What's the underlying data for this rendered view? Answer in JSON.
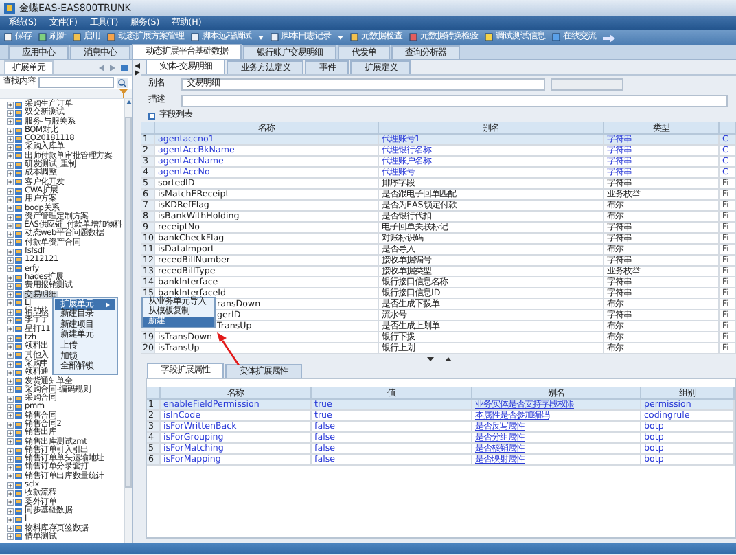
{
  "window": {
    "title": "金蝶EAS-EAS800TRUNK"
  },
  "menu": [
    "系统(S)",
    "文件(F)",
    "工具(T)",
    "服务(S)",
    "帮助(H)"
  ],
  "toolbar": [
    {
      "label": "保存",
      "dropdown": false
    },
    {
      "label": "刷新",
      "dropdown": false
    },
    {
      "label": "启用",
      "dropdown": false
    },
    {
      "label": "动态扩展方案管理",
      "dropdown": false
    },
    {
      "label": "脚本远程调试",
      "dropdown": true
    },
    {
      "label": "脚本日志记录",
      "dropdown": true
    },
    {
      "label": "元数据检查",
      "dropdown": false
    },
    {
      "label": "元数据转换检验",
      "dropdown": false
    },
    {
      "label": "调试测试信息",
      "dropdown": false
    },
    {
      "label": "在线交流",
      "dropdown": false
    }
  ],
  "tabs": [
    {
      "label": "应用中心",
      "selected": false
    },
    {
      "label": "消息中心",
      "selected": false
    },
    {
      "label": "动态扩展平台基础数据",
      "selected": true
    },
    {
      "label": "银行账户交易明细",
      "selected": false
    },
    {
      "label": "代发单",
      "selected": false
    },
    {
      "label": "查询分析器",
      "selected": false
    }
  ],
  "left_panel": {
    "title": "扩展单元",
    "search_label": "查找内容",
    "tree": [
      {
        "label": "采购生产订单",
        "selected": false
      },
      {
        "label": "双交新测试",
        "selected": false
      },
      {
        "label": "服务-与服关系",
        "selected": false
      },
      {
        "label": "BOM对比",
        "selected": false
      },
      {
        "label": "CO20181118",
        "selected": false
      },
      {
        "label": "采购入库单",
        "selected": false
      },
      {
        "label": "出师付款单审批管理方案",
        "selected": false
      },
      {
        "label": "研发测试_重制",
        "selected": false
      },
      {
        "label": "成本调整",
        "selected": false
      },
      {
        "label": "客户化开发",
        "selected": false
      },
      {
        "label": "CWA扩展",
        "selected": false
      },
      {
        "label": "用户方案",
        "selected": false
      },
      {
        "label": "bodp关系",
        "selected": false
      },
      {
        "label": "资产管理定制方案",
        "selected": false
      },
      {
        "label": "EAS供应链_付款单增加物料",
        "selected": false
      },
      {
        "label": "动态web平台问题数据",
        "selected": false
      },
      {
        "label": "付款单资产合同",
        "selected": false
      },
      {
        "label": "fsfsdf",
        "selected": false
      },
      {
        "label": "1212121",
        "selected": false
      },
      {
        "label": "erfy",
        "selected": false
      },
      {
        "label": "hades扩展",
        "selected": false
      },
      {
        "label": "费用报销测试",
        "selected": false
      },
      {
        "label": "交易明细",
        "selected": true
      },
      {
        "label": "LJ",
        "selected": false
      },
      {
        "label": "辅助核",
        "selected": false
      },
      {
        "label": "李宇宇",
        "selected": false
      },
      {
        "label": "星打11",
        "selected": false
      },
      {
        "label": "tzh",
        "selected": false
      },
      {
        "label": "领料出",
        "selected": false
      },
      {
        "label": "其他入",
        "selected": false
      },
      {
        "label": "采购申",
        "selected": false
      },
      {
        "label": "领料通",
        "selected": false
      },
      {
        "label": "发货通知单全",
        "selected": false
      },
      {
        "label": "采购合同-编码规则",
        "selected": false
      },
      {
        "label": "采购合同",
        "selected": false
      },
      {
        "label": "pmm",
        "selected": false
      },
      {
        "label": "销售合同",
        "selected": false
      },
      {
        "label": "销售合同2",
        "selected": false
      },
      {
        "label": "销售出库",
        "selected": false
      },
      {
        "label": "销售出库测试zmt",
        "selected": false
      },
      {
        "label": "销售订单引入引出",
        "selected": false
      },
      {
        "label": "销售订单单头运输地址",
        "selected": false
      },
      {
        "label": "销售订单分录套打",
        "selected": false
      },
      {
        "label": "销售订单出库数量统计",
        "selected": false
      },
      {
        "label": "sclx",
        "selected": false
      },
      {
        "label": "收款流程",
        "selected": false
      },
      {
        "label": "委外订单",
        "selected": false
      },
      {
        "label": "同步基础数据",
        "selected": false
      },
      {
        "label": "l",
        "selected": false
      },
      {
        "label": "物料库存页签数据",
        "selected": false
      },
      {
        "label": "借单测试",
        "selected": false
      }
    ]
  },
  "entity_tabs": [
    {
      "label": "实体-交易明细",
      "selected": true
    },
    {
      "label": "业务方法定义",
      "selected": false
    },
    {
      "label": "事件",
      "selected": false
    },
    {
      "label": "扩展定义",
      "selected": false
    }
  ],
  "form": [
    {
      "label": "别名",
      "value": "交易明细"
    },
    {
      "label": "描述"
    }
  ],
  "field_list": {
    "title": "字段列表",
    "columns": [
      "名称",
      "别名",
      "类型"
    ],
    "rows": [
      {
        "num": "1",
        "name": "agentaccno1",
        "alias": "代理账号1",
        "type": "字符串",
        "column_4": "C",
        "kind": "extended",
        "selected": true
      },
      {
        "num": "2",
        "name": "agentAccBkName",
        "alias": "代理银行名称",
        "type": "字符串",
        "column_4": "C",
        "kind": "extended",
        "selected": false
      },
      {
        "num": "3",
        "name": "agentAccName",
        "alias": "代理账户名称",
        "type": "字符串",
        "column_4": "C",
        "kind": "extended",
        "selected": false
      },
      {
        "num": "4",
        "name": "agentAccNo",
        "alias": "代理账号",
        "type": "字符串",
        "column_4": "C",
        "kind": "extended",
        "selected": false
      },
      {
        "num": "5",
        "name": "sortedID",
        "alias": "排序字段",
        "type": "字符串",
        "column_4": "Fi",
        "kind": "plain",
        "selected": false
      },
      {
        "num": "6",
        "name": "isMatchEReceipt",
        "alias": "是否跟电子回单匹配",
        "type": "业务枚举",
        "column_4": "Fi",
        "kind": "plain",
        "selected": false
      },
      {
        "num": "7",
        "name": "isKDRefFlag",
        "alias": "是否为EAS锁定付款",
        "type": "布尔",
        "column_4": "Fi",
        "kind": "plain",
        "selected": false
      },
      {
        "num": "8",
        "name": "isBankWithHolding",
        "alias": "是否银行代扣",
        "type": "布尔",
        "column_4": "Fi",
        "kind": "plain",
        "selected": false
      },
      {
        "num": "9",
        "name": "receiptNo",
        "alias": "电子回单关联标记",
        "type": "字符串",
        "column_4": "Fi",
        "kind": "plain",
        "selected": false
      },
      {
        "num": "10",
        "name": "bankCheckFlag",
        "alias": "对账标识码",
        "type": "字符串",
        "column_4": "Fi",
        "kind": "plain",
        "selected": false
      },
      {
        "num": "11",
        "name": "isDataImport",
        "alias": "是否导入",
        "type": "布尔",
        "column_4": "Fi",
        "kind": "plain",
        "selected": false
      },
      {
        "num": "12",
        "name": "recedBillNumber",
        "alias": "接收单据编号",
        "type": "字符串",
        "column_4": "Fi",
        "kind": "plain",
        "selected": false
      },
      {
        "num": "13",
        "name": "recedBillType",
        "alias": "接收单据类型",
        "type": "业务枚举",
        "column_4": "Fi",
        "kind": "plain",
        "selected": false
      },
      {
        "num": "14",
        "name": "bankInterface",
        "alias": "银行接口信息名称",
        "type": "字符串",
        "column_4": "Fi",
        "kind": "plain",
        "selected": false
      },
      {
        "num": "15",
        "name": "bankInterfaceId",
        "alias": "银行接口信息ID",
        "type": "字符串",
        "column_4": "Fi",
        "kind": "plain",
        "selected": false
      },
      {
        "name": "ransDown",
        "alias": "是否生成下拨单",
        "type": "布尔",
        "column_4": "Fi",
        "kind": "covered",
        "selected": false
      },
      {
        "name": "gerID",
        "alias": "流水号",
        "type": "字符串",
        "column_4": "Fi",
        "kind": "covered",
        "selected": false
      },
      {
        "name": "TransUp",
        "alias": "是否生成上划单",
        "type": "布尔",
        "column_4": "Fi",
        "kind": "covered",
        "selected": false
      },
      {
        "num": "19",
        "name": "isTransDown",
        "alias": "银行下拨",
        "type": "布尔",
        "column_4": "Fi",
        "kind": "plain",
        "selected": false
      },
      {
        "num": "20",
        "name": "isTransUp",
        "alias": "银行上划",
        "type": "布尔",
        "column_4": "Fi",
        "kind": "plain",
        "selected": false
      }
    ]
  },
  "property_tabs": [
    {
      "label": "字段扩展属性",
      "selected": true
    },
    {
      "label": "实体扩展属性",
      "selected": false
    }
  ],
  "properties": {
    "columns": [
      "名称",
      "值",
      "别名",
      "组别"
    ],
    "rows": [
      {
        "num": "1",
        "name": "enableFieldPermission",
        "value": "true",
        "alias": "业务实体是否支持字段权限",
        "group": "permission",
        "selected": true
      },
      {
        "num": "2",
        "name": "isInCode",
        "value": "true",
        "alias": "本属性是否参加编码",
        "group": "codingrule",
        "selected": false
      },
      {
        "num": "3",
        "name": "isForWrittenBack",
        "value": "false",
        "alias": "是否反写属性",
        "group": "botp",
        "selected": false
      },
      {
        "num": "4",
        "name": "isForGrouping",
        "value": "false",
        "alias": "是否分组属性",
        "group": "botp",
        "selected": false
      },
      {
        "num": "5",
        "name": "isForMatching",
        "value": "false",
        "alias": "是否核销属性",
        "group": "botp",
        "selected": false
      },
      {
        "num": "6",
        "name": "isForMapping",
        "value": "false",
        "alias": "是否映射属性",
        "group": "botp",
        "selected": false
      }
    ]
  },
  "context_menu": [
    {
      "label": "扩展单元",
      "submenu": true,
      "selected": true
    },
    {
      "label": "新建目录",
      "submenu": false,
      "selected": false
    },
    {
      "label": "新建项目",
      "submenu": false,
      "selected": false
    },
    {
      "label": "新建单元",
      "submenu": false,
      "selected": false
    },
    {
      "label": "上传",
      "submenu": false,
      "selected": false
    },
    {
      "label": "加锁",
      "submenu": false,
      "selected": false
    },
    {
      "label": "全部解锁",
      "submenu": false,
      "selected": false
    }
  ],
  "submenu": [
    {
      "label": "从业务单元导入",
      "selected": false
    },
    {
      "label": "从模板复制",
      "selected": false
    },
    {
      "label": "新建",
      "selected": true
    }
  ]
}
